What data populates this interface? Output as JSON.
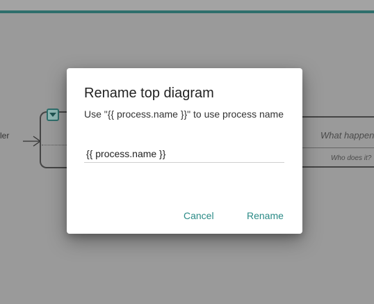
{
  "background": {
    "actor_label_partial": "ler",
    "task_what_placeholder": "What happen",
    "task_who_placeholder": "Who does it?",
    "accent_color": "#2f6f6c"
  },
  "dialog": {
    "title": "Rename top diagram",
    "description": "Use \"{{ process.name }}\" to use process name",
    "input_value": "{{ process.name }}",
    "cancel_label": "Cancel",
    "rename_label": "Rename",
    "button_color": "#2a8a86"
  }
}
